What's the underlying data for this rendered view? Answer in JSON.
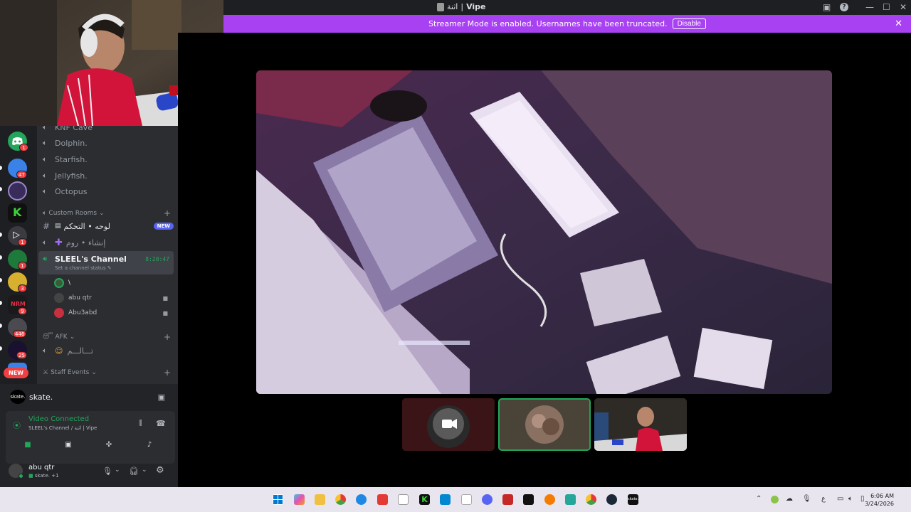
{
  "window": {
    "title_prefix": "اثنة",
    "title_name": "Vipe"
  },
  "banner": {
    "message": "Streamer Mode is enabled. Usernames have been truncated.",
    "disable_label": "Disable"
  },
  "servers": [
    {
      "badge": "1"
    },
    {
      "badge": "47"
    },
    {
      "badge": ""
    },
    {
      "badge": ""
    },
    {
      "badge": "1"
    },
    {
      "badge": "1"
    },
    {
      "badge": "3"
    },
    {
      "badge": "9"
    },
    {
      "badge": "446"
    },
    {
      "badge": "25"
    }
  ],
  "new_pill": "NEW",
  "channels": {
    "voice": [
      "KNF Cave",
      "Dolphin.",
      "Starfish.",
      "Jellyfish.",
      "Octopus"
    ],
    "custom_rooms_label": "Custom Rooms",
    "text_channel": "لوحه • التحكم",
    "new_badge": "NEW",
    "create_room": "إنشاء • روم",
    "active": {
      "name": "SLEEL's Channel",
      "timer": "8:20:47",
      "status": "Set a channel status"
    },
    "users": [
      {
        "name": "\\"
      },
      {
        "name": "abu qtr"
      },
      {
        "name": "Abu3abd"
      }
    ],
    "afk_label": "AFK",
    "afk_channel": "تـــالـــم",
    "staff_label": "Staff Events"
  },
  "voice_panel": {
    "activity": "skate.",
    "status": "Video Connected",
    "channel_path": "SLEEL's Channel / اثنة | Vipe"
  },
  "user": {
    "name": "abu qtr",
    "activity": "skate. +1"
  },
  "clock": {
    "time": "6:06 AM",
    "date": "3/24/2026"
  },
  "tray": {
    "lang": "ع"
  },
  "colors": {
    "accent": "#a841f2",
    "connected": "#23a55a",
    "badge": "#f23f42"
  }
}
